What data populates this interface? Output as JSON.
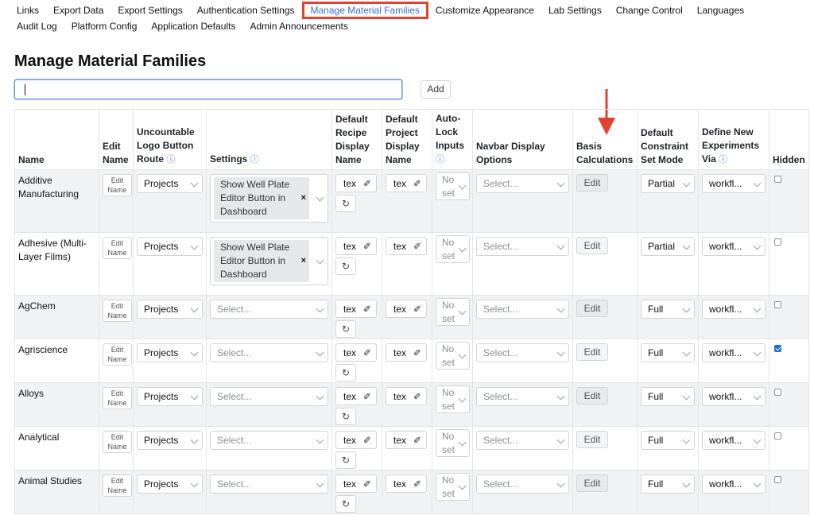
{
  "nav": {
    "row1": [
      "Links",
      "Export Data",
      "Export Settings",
      "Authentication Settings",
      "Manage Material Families",
      "Customize Appearance",
      "Lab Settings",
      "Change Control",
      "Languages"
    ],
    "row2": [
      "Audit Log",
      "Platform Config",
      "Application Defaults",
      "Admin Announcements"
    ],
    "active": "Manage Material Families"
  },
  "page": {
    "title": "Manage Material Families",
    "search_value": "",
    "add_label": "Add"
  },
  "table": {
    "headers": {
      "name": "Name",
      "edit_name": "Edit Name",
      "logo_route": "Uncountable Logo Button Route",
      "settings": "Settings",
      "recipe_display": "Default Recipe Display Name",
      "project_display": "Default Project Display Name",
      "auto_lock": "Auto-Lock Inputs",
      "navbar": "Navbar Display Options",
      "basis": "Basis Calculations",
      "constraint": "Default Constraint Set Mode",
      "define_new": "Define New Experiments Via",
      "hidden": "Hidden"
    },
    "info_glyph": "ⓘ",
    "edit_name_label": "Edit Name",
    "edit_label": "Edit",
    "text_value": "tex",
    "pencil_glyph": "✐",
    "reset_glyph": "↻",
    "select_placeholder": "Select...",
    "auto_lock_value": "No set",
    "tag_remove_glyph": "×",
    "rows": [
      {
        "name": "Additive Manufacturing",
        "route": "Projects",
        "settings_tag": "Show Well Plate Editor Button in Dashboard",
        "recipe_reset": true,
        "constraint": "Partial",
        "define_new": "workfl...",
        "hidden": false
      },
      {
        "name": "Adhesive (Multi-Layer Films)",
        "route": "Projects",
        "settings_tag": "Show Well Plate Editor Button in Dashboard",
        "recipe_reset": true,
        "constraint": "Partial",
        "define_new": "workfl...",
        "hidden": false
      },
      {
        "name": "AgChem",
        "route": "Projects",
        "settings_tag": null,
        "recipe_reset": true,
        "constraint": "Full",
        "define_new": "workfl...",
        "hidden": false
      },
      {
        "name": "Agriscience",
        "route": "Projects",
        "settings_tag": null,
        "recipe_reset": true,
        "constraint": "Full",
        "define_new": "workfl...",
        "hidden": true
      },
      {
        "name": "Alloys",
        "route": "Projects",
        "settings_tag": null,
        "recipe_reset": true,
        "constraint": "Full",
        "define_new": "workfl...",
        "hidden": false
      },
      {
        "name": "Analytical",
        "route": "Projects",
        "settings_tag": null,
        "recipe_reset": true,
        "constraint": "Full",
        "define_new": "workfl...",
        "hidden": false
      },
      {
        "name": "Animal Studies",
        "route": "Projects",
        "settings_tag": null,
        "recipe_reset": true,
        "constraint": "Full",
        "define_new": "workfl...",
        "hidden": false
      }
    ]
  },
  "colors": {
    "highlight_box": "#e5412f",
    "active_link": "#3b6fd8",
    "checkbox_checked": "#1f6fd6",
    "arrow": "#e5412f"
  },
  "annotation": {
    "arrow_icon": "arrow-down-icon",
    "points_to": "Basis Calculations"
  }
}
